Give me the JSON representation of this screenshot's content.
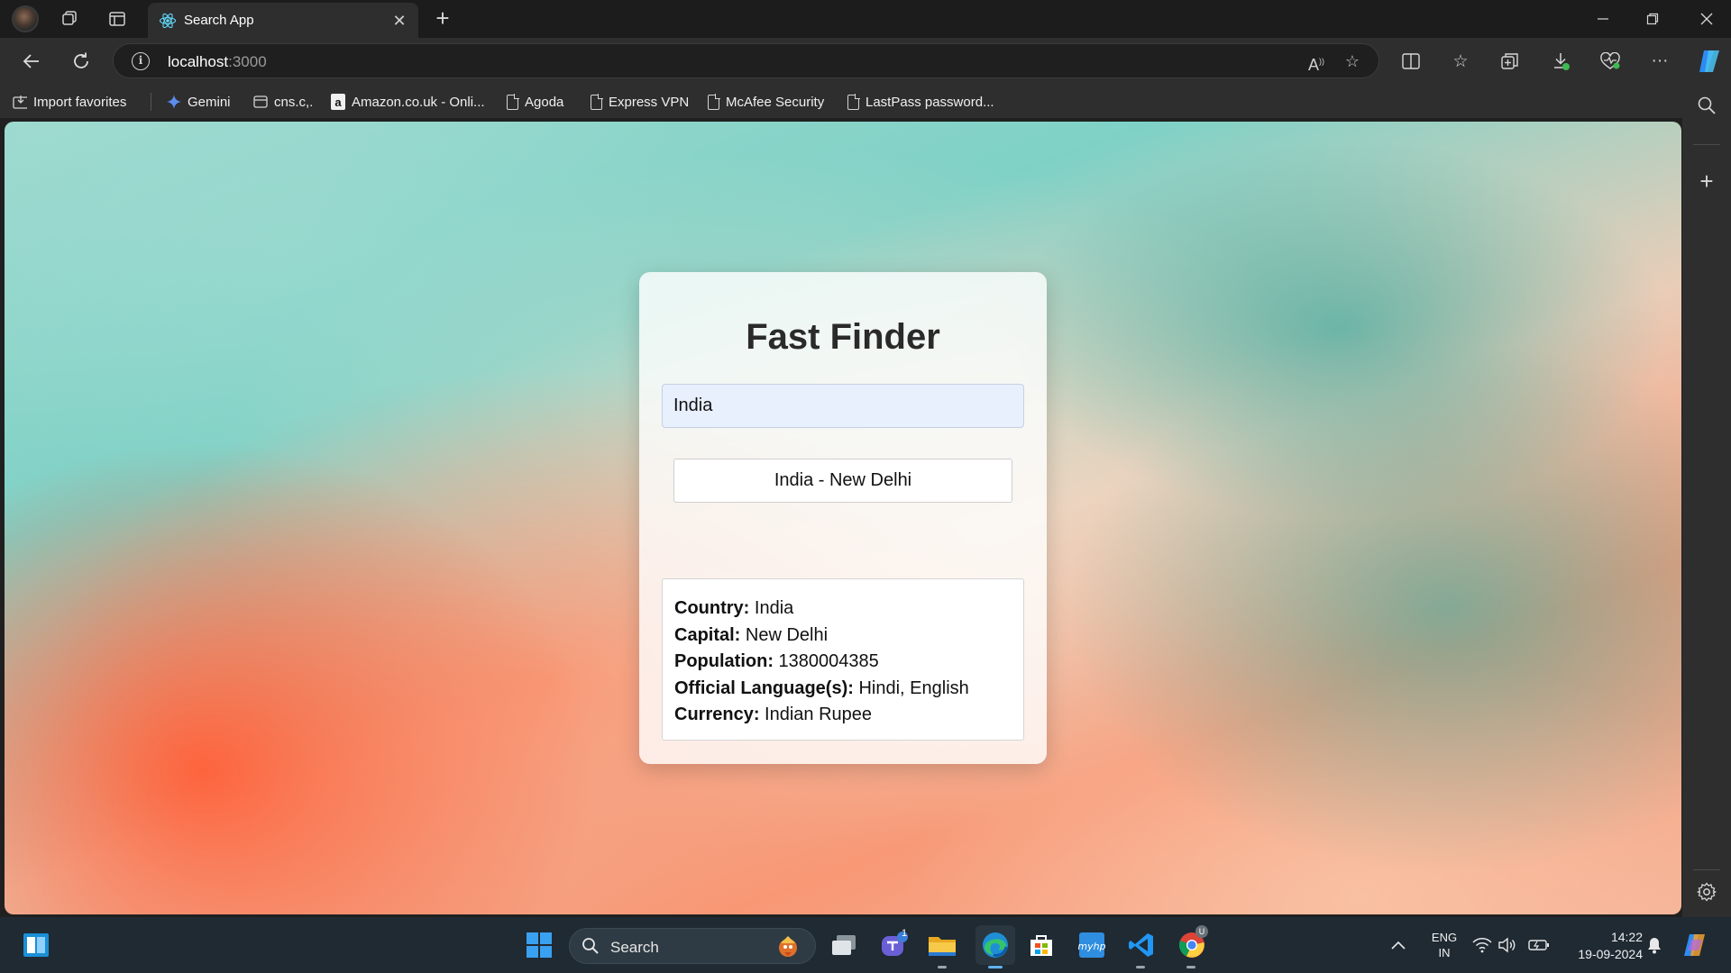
{
  "browser": {
    "tab": {
      "title": "Search App"
    },
    "address": {
      "host": "localhost",
      "port": ":3000"
    },
    "favorites": [
      {
        "label": "Import favorites",
        "icon": "import-favorites-icon"
      },
      {
        "label": "Gemini",
        "icon": "gemini-icon"
      },
      {
        "label": "cns.c,.",
        "icon": "site-icon"
      },
      {
        "label": "Amazon.co.uk - Onli...",
        "icon": "amazon-icon"
      },
      {
        "label": "Agoda",
        "icon": "page-icon"
      },
      {
        "label": "Express VPN",
        "icon": "page-icon"
      },
      {
        "label": "McAfee Security",
        "icon": "page-icon"
      },
      {
        "label": "LastPass password...",
        "icon": "page-icon"
      }
    ]
  },
  "app": {
    "title": "Fast Finder",
    "search": {
      "value": "India"
    },
    "suggestion": "India - New Delhi",
    "details": [
      {
        "label": "Country:",
        "value": "India"
      },
      {
        "label": "Capital:",
        "value": "New Delhi"
      },
      {
        "label": "Population:",
        "value": "1380004385"
      },
      {
        "label": "Official Language(s):",
        "value": "Hindi, English"
      },
      {
        "label": "Currency:",
        "value": "Indian Rupee"
      }
    ]
  },
  "taskbar": {
    "search_label": "Search",
    "teams_badge": "1",
    "chrome_badge": "U",
    "language": {
      "line1": "ENG",
      "line2": "IN"
    },
    "clock": {
      "time": "14:22",
      "date": "19-09-2024"
    }
  },
  "colors": {
    "accent": "#1a8fd6",
    "card_bg": "#ffffff",
    "input_bg": "#e8effd"
  }
}
